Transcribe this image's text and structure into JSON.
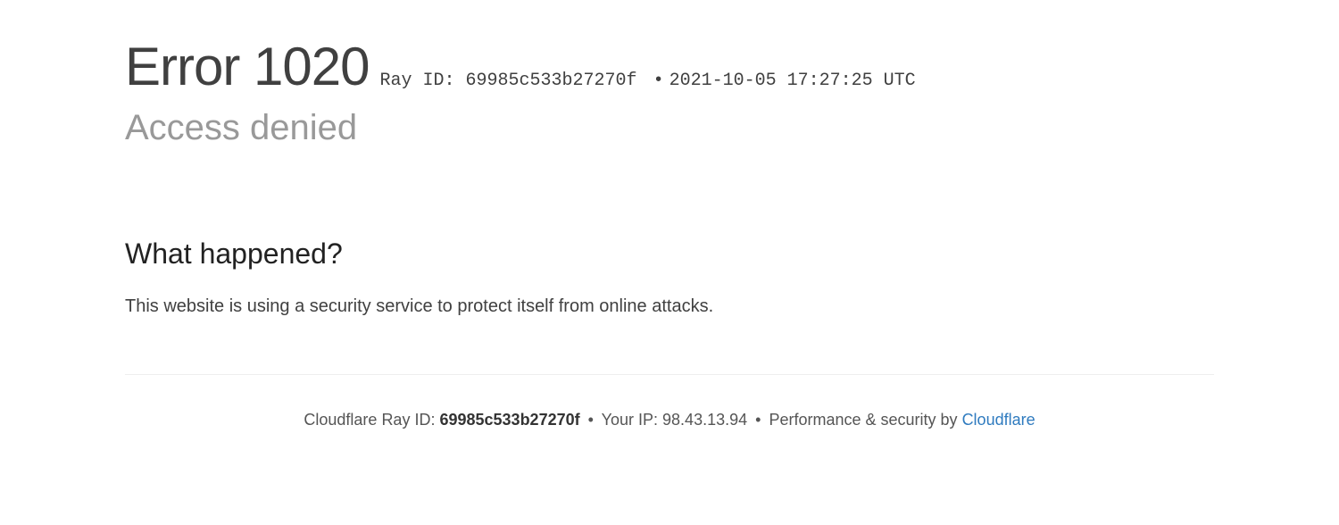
{
  "header": {
    "error_title": "Error 1020",
    "ray_id_label": "Ray ID:",
    "ray_id_value": "69985c533b27270f",
    "timestamp": "2021-10-05 17:27:25 UTC",
    "subtitle": "Access denied"
  },
  "section": {
    "heading": "What happened?",
    "text": "This website is using a security service to protect itself from online attacks."
  },
  "footer": {
    "ray_label": "Cloudflare Ray ID:",
    "ray_value": "69985c533b27270f",
    "ip_label": "Your IP:",
    "ip_value": "98.43.13.94",
    "perf_label": "Performance & security by",
    "provider": "Cloudflare"
  }
}
